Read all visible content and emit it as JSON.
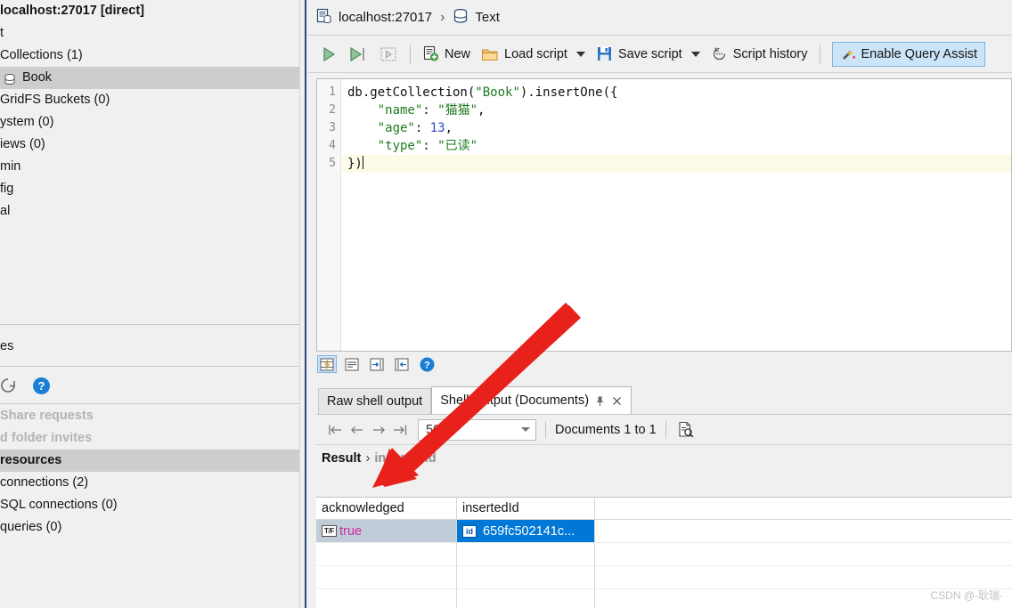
{
  "sidebar": {
    "tree": [
      {
        "label": "localhost:27017 [direct]",
        "bold": true,
        "selected": false,
        "icon": ""
      },
      {
        "label": "t",
        "bold": false,
        "selected": false,
        "icon": ""
      },
      {
        "label": "Collections (1)",
        "bold": false,
        "selected": false,
        "icon": ""
      },
      {
        "label": "Book",
        "bold": false,
        "selected": true,
        "icon": "collection-icon"
      },
      {
        "label": "GridFS Buckets (0)",
        "bold": false,
        "selected": false,
        "icon": ""
      },
      {
        "label": "ystem (0)",
        "bold": false,
        "selected": false,
        "icon": ""
      },
      {
        "label": "iews (0)",
        "bold": false,
        "selected": false,
        "icon": ""
      },
      {
        "label": "min",
        "bold": false,
        "selected": false,
        "icon": ""
      },
      {
        "label": "fig",
        "bold": false,
        "selected": false,
        "icon": ""
      },
      {
        "label": "al",
        "bold": false,
        "selected": false,
        "icon": ""
      }
    ],
    "section2_label": "es",
    "icons": [
      "refresh-icon",
      "help-icon"
    ],
    "list": [
      {
        "label": "Share requests",
        "style": "muted"
      },
      {
        "label": "d folder invites",
        "style": "muted"
      },
      {
        "label": "resources",
        "style": "header"
      },
      {
        "label": "connections (2)",
        "style": "normal"
      },
      {
        "label": "SQL connections (0)",
        "style": "normal"
      },
      {
        "label": "queries (0)",
        "style": "normal"
      }
    ]
  },
  "breadcrumb": {
    "server": "localhost:27017",
    "separator": "›",
    "database": "Text"
  },
  "toolbar": {
    "run_label": "",
    "new_label": "New",
    "load_script_label": "Load script",
    "save_script_label": "Save script",
    "script_history_label": "Script history",
    "query_assist_label": "Enable Query Assist"
  },
  "editor": {
    "line_numbers": [
      "1",
      "2",
      "3",
      "4",
      "5"
    ],
    "lines": [
      [
        {
          "t": "db.getCollection(",
          "c": "plain"
        },
        {
          "t": "\"Book\"",
          "c": "str"
        },
        {
          "t": ").insertOne({",
          "c": "plain"
        }
      ],
      [
        {
          "t": "    ",
          "c": "plain"
        },
        {
          "t": "\"name\"",
          "c": "str"
        },
        {
          "t": ": ",
          "c": "plain"
        },
        {
          "t": "\"猫猫\"",
          "c": "str"
        },
        {
          "t": ",",
          "c": "plain"
        }
      ],
      [
        {
          "t": "    ",
          "c": "plain"
        },
        {
          "t": "\"age\"",
          "c": "str"
        },
        {
          "t": ": ",
          "c": "plain"
        },
        {
          "t": "13",
          "c": "num"
        },
        {
          "t": ",",
          "c": "plain"
        }
      ],
      [
        {
          "t": "    ",
          "c": "plain"
        },
        {
          "t": "\"type\"",
          "c": "str"
        },
        {
          "t": ": ",
          "c": "plain"
        },
        {
          "t": "\"已读\"",
          "c": "str"
        }
      ],
      [
        {
          "t": "})",
          "c": "plain"
        }
      ]
    ],
    "current_line_index": 4,
    "bottom_icons": [
      "format-script-icon",
      "align-lines-icon",
      "indent-right-icon",
      "indent-left-icon",
      "help-icon"
    ]
  },
  "result": {
    "tabs": [
      {
        "label": "Raw shell output",
        "active": false,
        "pin": false,
        "close": false
      },
      {
        "label": "Shell Output (Documents)",
        "active": true,
        "pin": true,
        "close": true
      }
    ],
    "nav_icons": [
      "first-page-icon",
      "previous-page-icon",
      "next-page-icon",
      "last-page-icon"
    ],
    "page_size": "50",
    "document_range": "Documents 1 to 1",
    "view_icon": "document-view-icon",
    "crumb_root": "Result",
    "crumb_chev": "›",
    "crumb_field": "insertedId",
    "table": {
      "columns": [
        "acknowledged",
        "insertedId",
        ""
      ],
      "rows": [
        {
          "acknowledged": "true",
          "acknowledged_badge": "T/F",
          "insertedId": "659fc502141c...",
          "insertedId_badge": "id"
        }
      ],
      "empty_rows": 3
    }
  },
  "watermark": "CSDN @-耿瑞-",
  "colors": {
    "selection_blue": "#0078d7",
    "accent_button": "#cce4f7",
    "arrow_red": "#e8211a",
    "string_green": "#1f7a1f",
    "number_blue": "#2c49c9"
  }
}
